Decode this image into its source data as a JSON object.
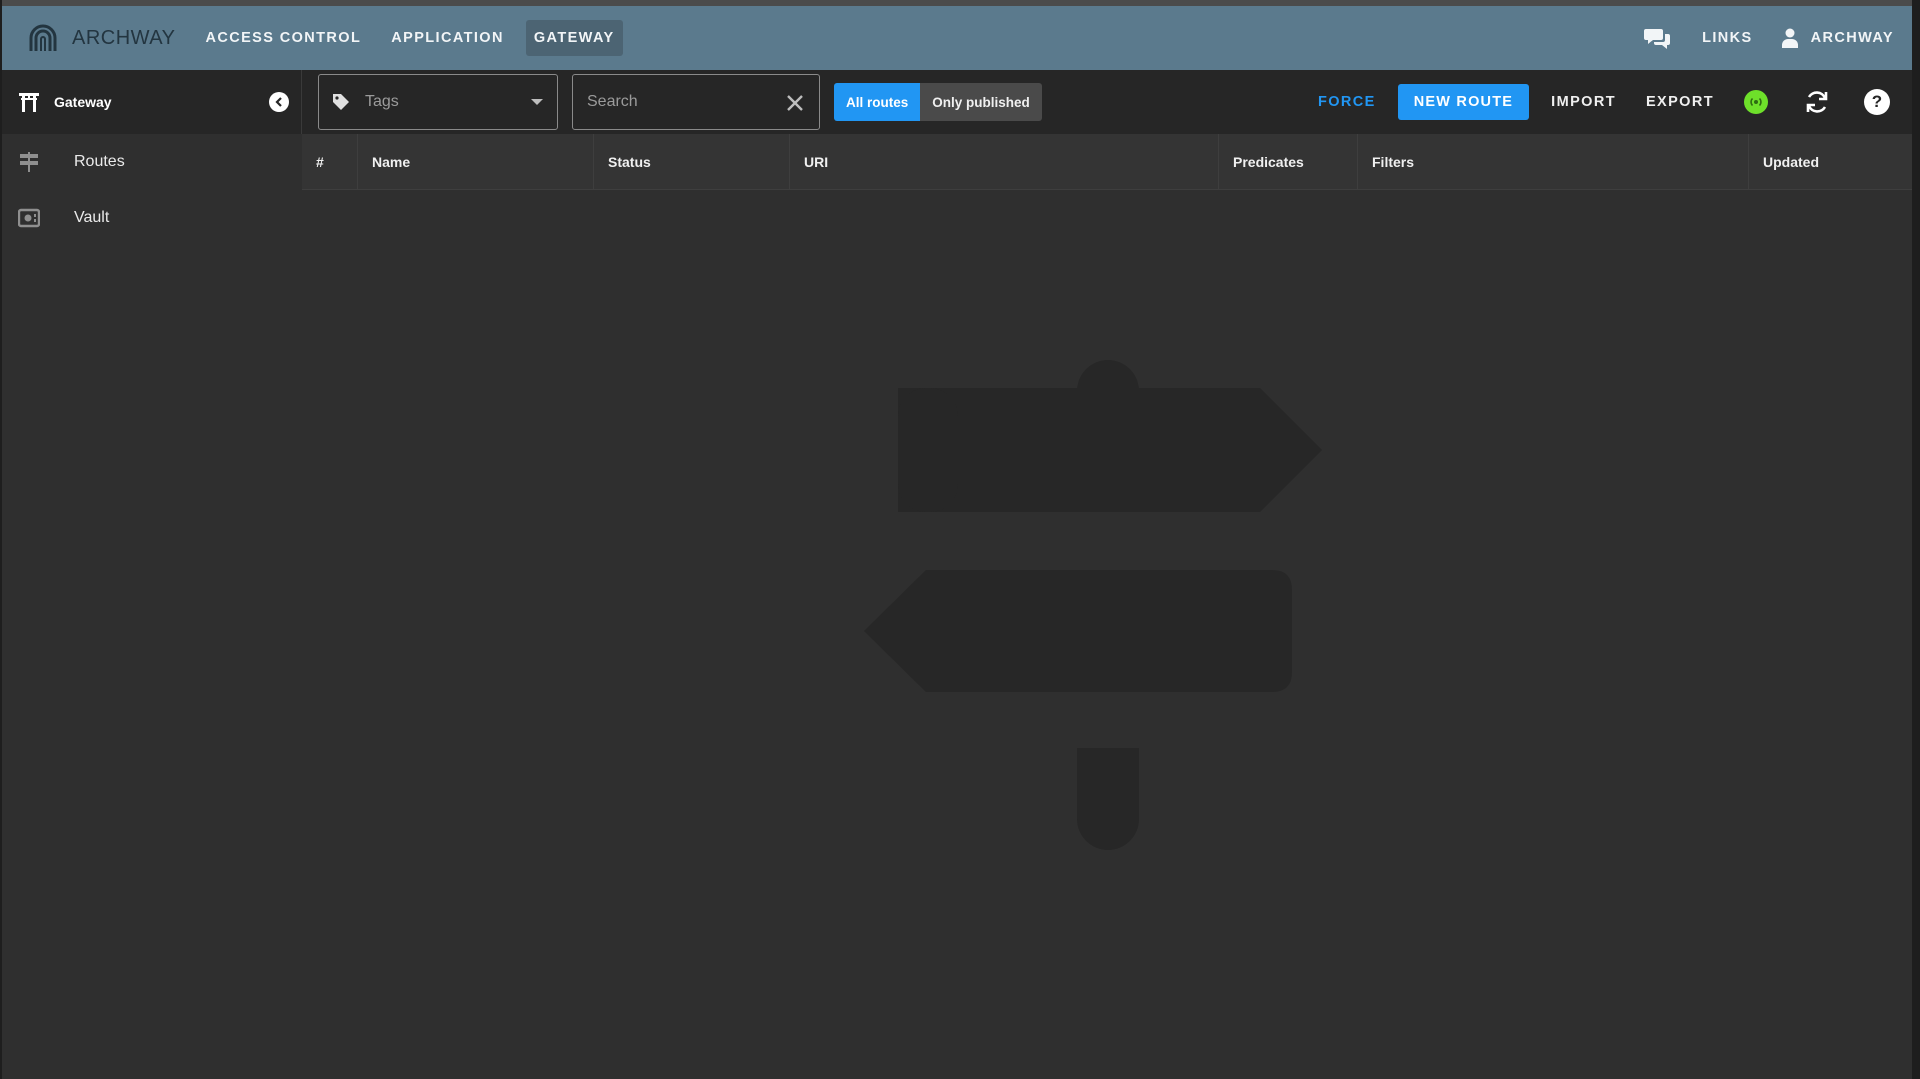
{
  "brand": {
    "name": "ARCHWAY"
  },
  "nav": {
    "items": [
      {
        "label": "ACCESS CONTROL"
      },
      {
        "label": "APPLICATION"
      },
      {
        "label": "GATEWAY"
      }
    ],
    "active": "GATEWAY"
  },
  "topbar": {
    "links_label": "LINKS",
    "user_label": "ARCHWAY",
    "icons": [
      "chat-icon",
      "user-icon"
    ]
  },
  "sidebar": {
    "title": "Gateway",
    "items": [
      {
        "label": "Routes",
        "icon": "routes-icon"
      },
      {
        "label": "Vault",
        "icon": "vault-icon"
      }
    ]
  },
  "toolbar": {
    "tags_placeholder": "Tags",
    "search_placeholder": "Search",
    "filter_all": "All routes",
    "filter_published": "Only published",
    "force_label": "FORCE",
    "new_route_label": "NEW ROUTE",
    "import_label": "IMPORT",
    "export_label": "EXPORT",
    "help_label": "?",
    "colors": {
      "accent": "#2196f3",
      "status": "#6ee02a",
      "topbar": "#5b7a8d"
    }
  },
  "table": {
    "columns": [
      "#",
      "Name",
      "Status",
      "URI",
      "Predicates",
      "Filters",
      "Updated"
    ],
    "rows": []
  }
}
